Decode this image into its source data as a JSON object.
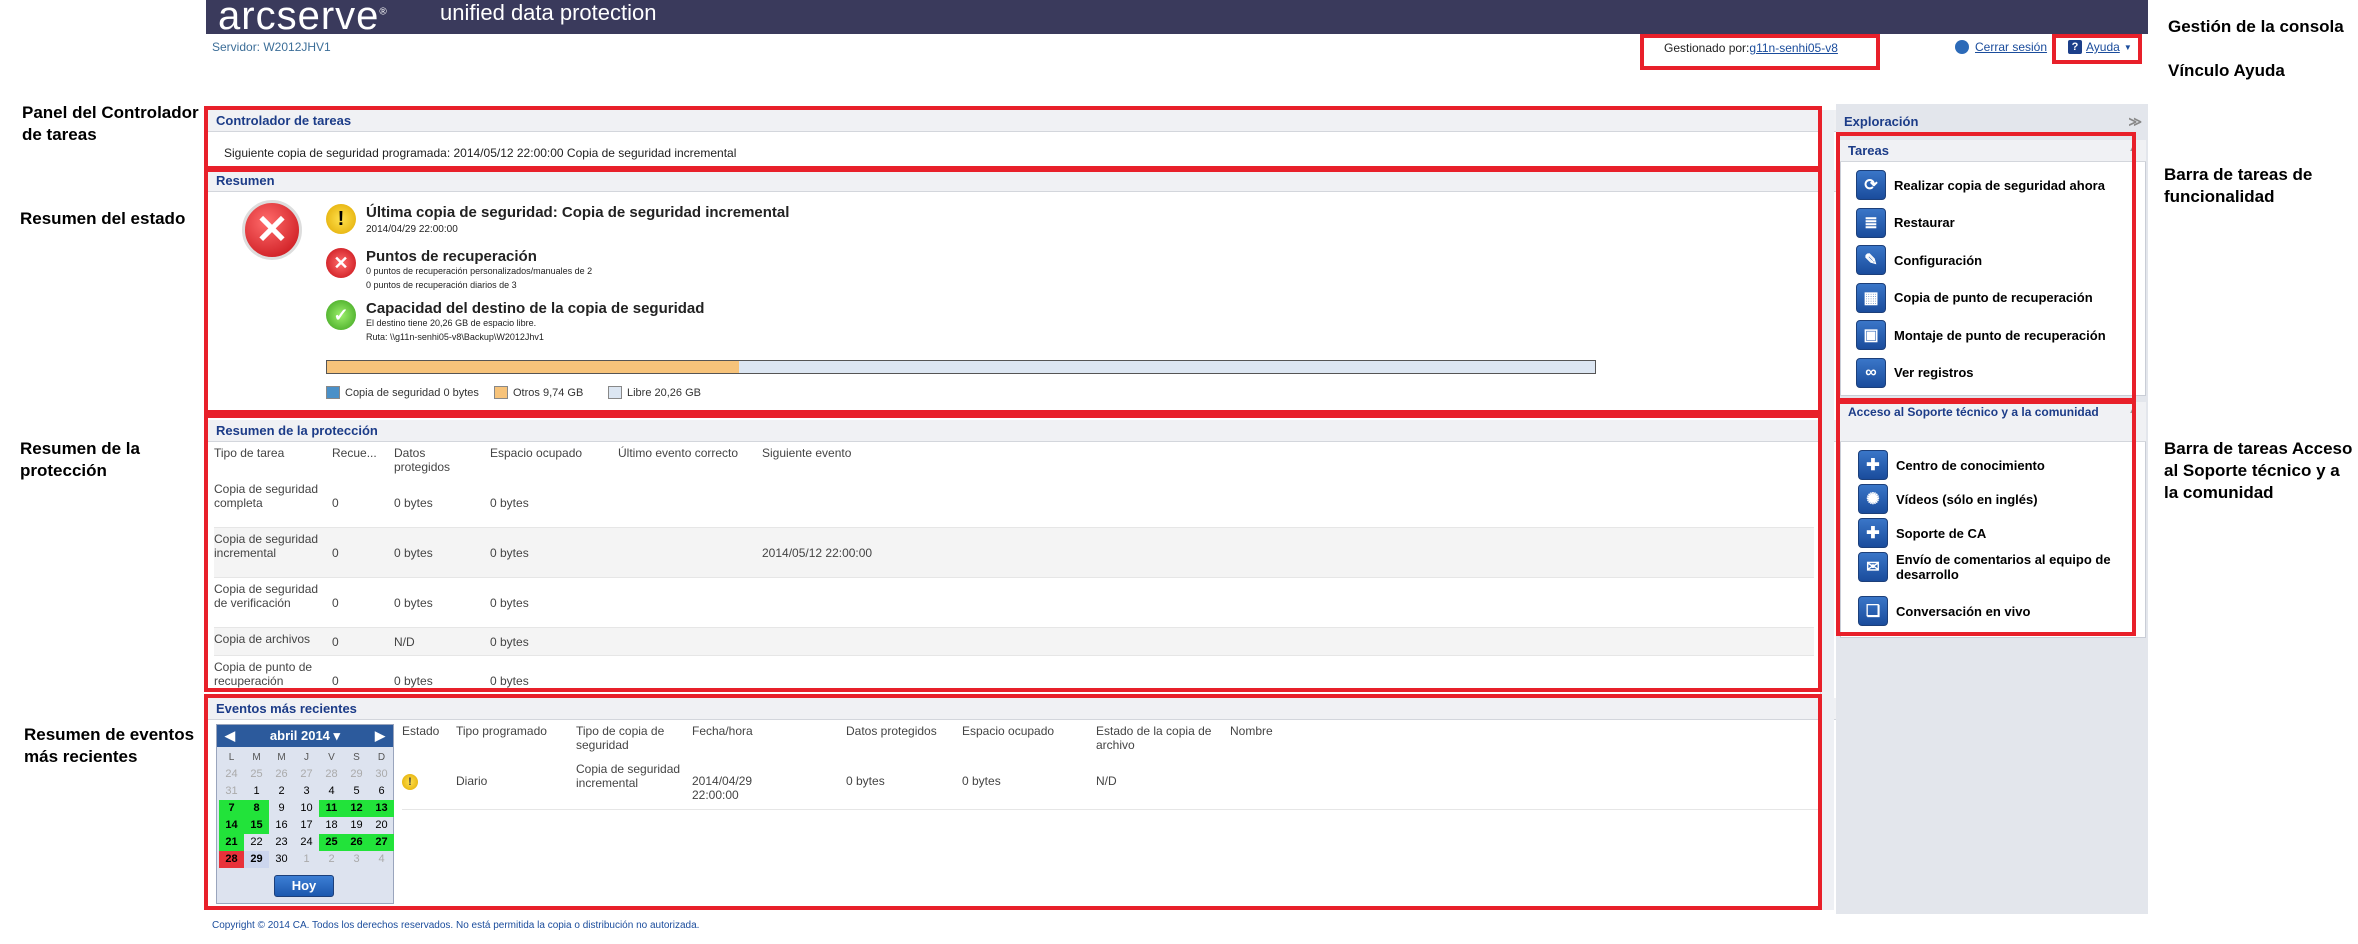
{
  "header": {
    "logo": "arcserve",
    "logo_mark": "®",
    "subtitle": "unified data protection",
    "server": "Servidor: W2012JHV1",
    "managed_prefix": "Gestionado por:",
    "managed_link": "g11n-senhi05-v8",
    "logout": "Cerrar sesión",
    "help": "Ayuda"
  },
  "annotations": {
    "console_management": "Gestión de la consola",
    "help_link": "Vínculo Ayuda",
    "task_monitor_panel": "Panel del Controlador de tareas",
    "status_summary": "Resumen del estado",
    "protection_summary": "Resumen de la protección",
    "recent_events": "Resumen de eventos más recientes",
    "functionality_taskbar": "Barra de tareas de funcionalidad",
    "support_taskbar": "Barra de tareas Acceso al Soporte técnico y a la comunidad"
  },
  "job_monitor": {
    "title": "Controlador de tareas",
    "text": "Siguiente copia de seguridad programada: 2014/05/12 22:00:00 Copia de seguridad incremental"
  },
  "summary": {
    "title": "Resumen",
    "last_backup_title": "Última copia de seguridad: Copia de seguridad incremental",
    "last_backup_time": "2014/04/29 22:00:00",
    "rp_title": "Puntos de recuperación",
    "rp_line1": "0 puntos de recuperación personalizados/manuales de 2",
    "rp_line2": "0 puntos de recuperación diarios de 3",
    "dest_title": "Capacidad del destino de la copia de seguridad",
    "dest_line1": "El destino tiene 20,26 GB de espacio libre.",
    "dest_line2": "Ruta: \\\\g11n-senhi05-v8\\Backup\\W2012Jhv1",
    "usage": {
      "backup_fraction": 0.0,
      "others_fraction": 0.325,
      "free_fraction": 0.675
    },
    "legend_backup": "Copia de seguridad 0 bytes",
    "legend_others": "Otros 9,74 GB",
    "legend_free": "Libre 20,26 GB",
    "colors": {
      "backup": "#4a90c8",
      "others": "#f7c37a",
      "free": "#dce6f2"
    }
  },
  "protection": {
    "title": "Resumen de la protección",
    "headers": [
      "Tipo de tarea",
      "Recue...",
      "Datos protegidos",
      "Espacio ocupado",
      "Último evento correcto",
      "Siguiente evento"
    ],
    "rows": [
      {
        "type": "Copia de seguridad completa",
        "rec": "0",
        "data": "0 bytes",
        "space": "0 bytes",
        "last": "",
        "next": ""
      },
      {
        "type": "Copia de seguridad incremental",
        "rec": "0",
        "data": "0 bytes",
        "space": "0 bytes",
        "last": "",
        "next": "2014/05/12 22:00:00"
      },
      {
        "type": "Copia de seguridad de verificación",
        "rec": "0",
        "data": "0 bytes",
        "space": "0 bytes",
        "last": "",
        "next": ""
      },
      {
        "type": "Copia de archivos",
        "rec": "0",
        "data": "N/D",
        "space": "0 bytes",
        "last": "",
        "next": ""
      },
      {
        "type": "Copia de punto de recuperación",
        "rec": "0",
        "data": "0 bytes",
        "space": "0 bytes",
        "last": "",
        "next": ""
      }
    ]
  },
  "events": {
    "title": "Eventos más recientes",
    "calendar": {
      "month": "abril 2014",
      "days_header": [
        "L",
        "M",
        "M",
        "J",
        "V",
        "S",
        "D"
      ],
      "today_button": "Hoy"
    },
    "headers": [
      "Estado",
      "Tipo programado",
      "Tipo de copia de seguridad",
      "Fecha/hora",
      "Datos protegidos",
      "Espacio ocupado",
      "Estado de la copia de archivo",
      "Nombre"
    ],
    "rows": [
      {
        "status_icon": "warning-icon",
        "sched": "Diario",
        "type": "Copia de seguridad incremental",
        "date": "2014/04/29 22:00:00",
        "data": "0 bytes",
        "space": "0 bytes",
        "fc_status": "N/D",
        "name": ""
      }
    ]
  },
  "footer": "Copyright © 2014 CA. Todos los derechos reservados. No está permitida la copia o distribución no autorizada.",
  "sidebar": {
    "navigation": "Exploración",
    "tasks_title": "Tareas",
    "tasks": [
      {
        "label": "Realizar copia de seguridad ahora",
        "icon": "backup-icon"
      },
      {
        "label": "Restaurar",
        "icon": "restore-icon"
      },
      {
        "label": "Configuración",
        "icon": "settings-icon"
      },
      {
        "label": "Copia de punto de recuperación",
        "icon": "copy-rp-icon"
      },
      {
        "label": "Montaje de punto de recuperación",
        "icon": "mount-icon"
      },
      {
        "label": "Ver registros",
        "icon": "logs-icon"
      }
    ],
    "support_title": "Acceso al Soporte técnico y a la comunidad",
    "support": [
      {
        "label": "Centro de conocimiento",
        "icon": "knowledge-icon"
      },
      {
        "label": "Vídeos (sólo en inglés)",
        "icon": "video-icon"
      },
      {
        "label": "Soporte de CA",
        "icon": "support-icon"
      },
      {
        "label": "Envío de comentarios al equipo de desarrollo",
        "icon": "feedback-icon"
      },
      {
        "label": "Conversación en vivo",
        "icon": "chat-icon"
      }
    ]
  }
}
